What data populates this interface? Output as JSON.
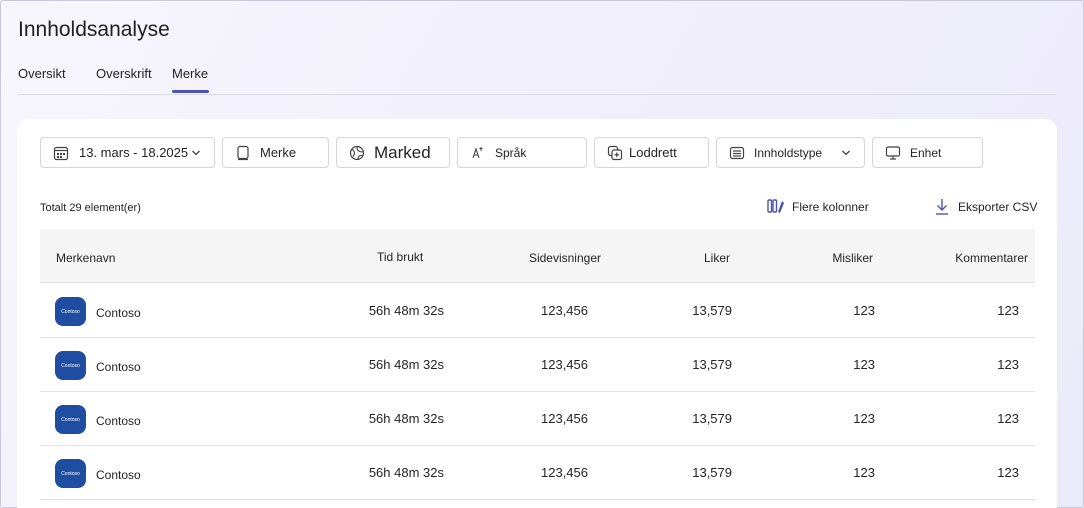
{
  "page_title": "Innholdsanalyse",
  "tabs": [
    {
      "label": "Oversikt",
      "active": false
    },
    {
      "label": "Overskrift",
      "active": false
    },
    {
      "label": "Merke",
      "active": true
    }
  ],
  "filters": {
    "date": {
      "label": "13. mars - 18.2025",
      "icon": "calendar-icon"
    },
    "brand": {
      "label": "Merke",
      "icon": "tablet-icon"
    },
    "market": {
      "label": "Marked",
      "icon": "globe-icon"
    },
    "language": {
      "label": "Språk",
      "icon": "translate-icon"
    },
    "vertical": {
      "label": "Loddrett",
      "icon": "add-layers-icon"
    },
    "content_type": {
      "label": "Innholdstype",
      "icon": "content-icon"
    },
    "device": {
      "label": "Enhet",
      "icon": "monitor-icon"
    }
  },
  "summary": {
    "total_text": "Totalt 29 element(er)"
  },
  "actions": {
    "more_columns": "Flere kolonner",
    "export_csv": "Eksporter CSV"
  },
  "table": {
    "columns": [
      "Merkenavn",
      "Tid brukt",
      "Sidevisninger",
      "Liker",
      "Misliker",
      "Kommentarer"
    ],
    "rows": [
      {
        "logo_text": "Contoso",
        "name": "Contoso",
        "time": "56h 48m 32s",
        "views": "123,456",
        "likes": "13,579",
        "dislikes": "123",
        "comments": "123"
      },
      {
        "logo_text": "Contoso",
        "name": "Contoso",
        "time": "56h 48m 32s",
        "views": "123,456",
        "likes": "13,579",
        "dislikes": "123",
        "comments": "123"
      },
      {
        "logo_text": "Contoso",
        "name": "Contoso",
        "time": "56h 48m 32s",
        "views": "123,456",
        "likes": "13,579",
        "dislikes": "123",
        "comments": "123"
      },
      {
        "logo_text": "Contoso",
        "name": "Contoso",
        "time": "56h 48m 32s",
        "views": "123,456",
        "likes": "13,579",
        "dislikes": "123",
        "comments": "123"
      }
    ]
  },
  "colors": {
    "accent": "#4f52b2",
    "logo": "#1e4da1"
  }
}
